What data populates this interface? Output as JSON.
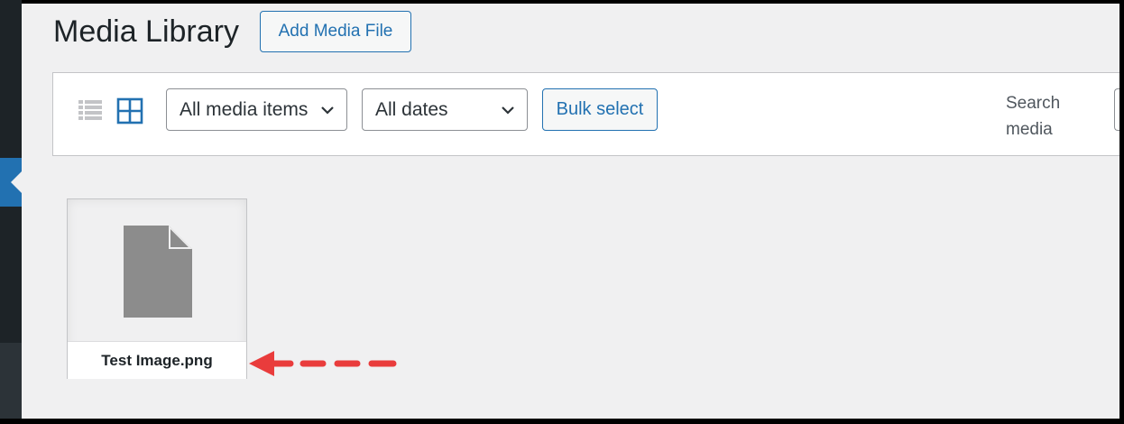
{
  "header": {
    "title": "Media Library",
    "add_button_label": "Add Media File"
  },
  "toolbar": {
    "view_modes": [
      "list-view-icon",
      "grid-view-icon"
    ],
    "active_view": "grid",
    "filter_type_selected": "All media items",
    "filter_date_selected": "All dates",
    "bulk_select_label": "Bulk select",
    "search_label": "Search media"
  },
  "attachments": [
    {
      "filename": "Test Image.png",
      "icon": "document-icon"
    }
  ],
  "colors": {
    "accent": "#2271b1",
    "background": "#f0f0f1",
    "annotation_arrow": "#e93c3c",
    "file_icon": "#8c8c8c"
  }
}
